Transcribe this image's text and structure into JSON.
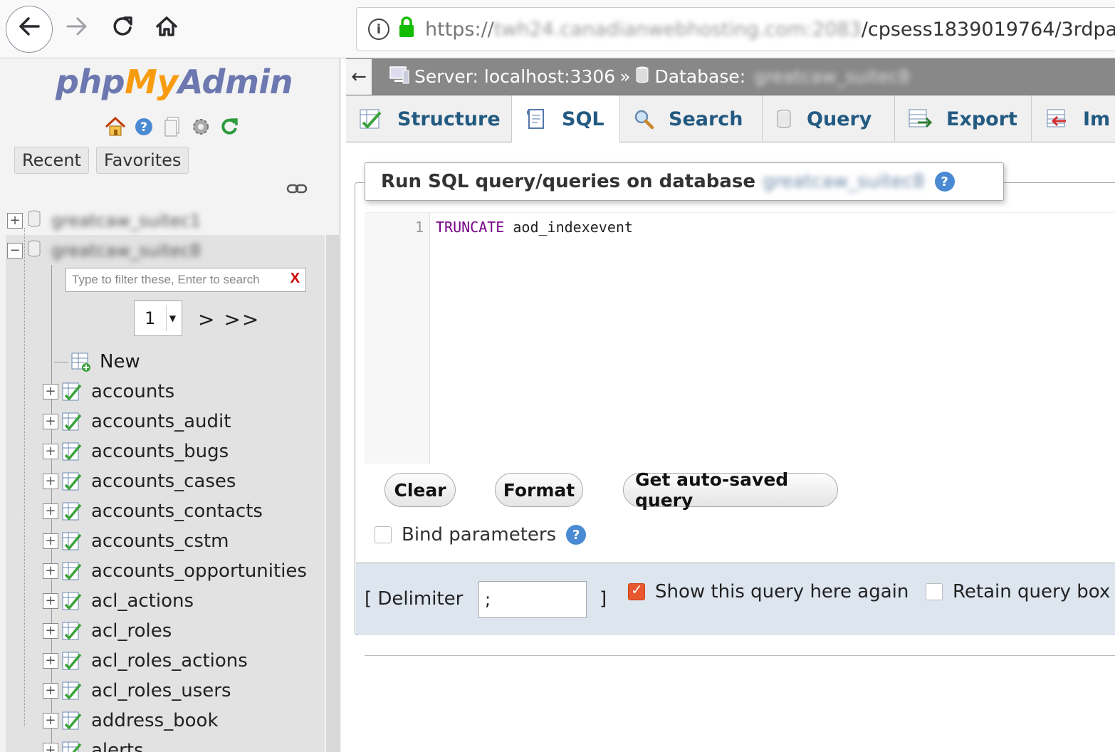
{
  "browser": {
    "url_scheme": "https://",
    "url_host": "twh24.canadianwebhosting.com:2083",
    "url_path": "/cpsess1839019764/3rdpa"
  },
  "nav": {
    "logo_php": "php",
    "logo_my": "My",
    "logo_admin": "Admin",
    "recent_label": "Recent",
    "favorites_label": "Favorites",
    "databases": [
      "greatcaw_suitec1",
      "greatcaw_suitec8"
    ],
    "filter_placeholder": "Type to filter these, Enter to search",
    "filter_clear": "X",
    "page_value": "1",
    "page_next": "> >>",
    "new_label": "New",
    "tables": [
      "accounts",
      "accounts_audit",
      "accounts_bugs",
      "accounts_cases",
      "accounts_contacts",
      "accounts_cstm",
      "accounts_opportunities",
      "acl_actions",
      "acl_roles",
      "acl_roles_actions",
      "acl_roles_users",
      "address_book",
      "alerts"
    ]
  },
  "topbar": {
    "collapse": "←",
    "server_label": "Server: localhost:3306",
    "separator": "»",
    "database_label": "Database:",
    "database_name": "greatcaw_suitec8"
  },
  "tabs": [
    "Structure",
    "SQL",
    "Search",
    "Query",
    "Export",
    "Im"
  ],
  "sql": {
    "legend_title": "Run SQL query/queries on database",
    "legend_db": "greatcaw_suitec8",
    "line_number": "1",
    "keyword": "TRUNCATE",
    "code_rest": " aod_indexevent",
    "clear_label": "Clear",
    "format_label": "Format",
    "autosave_label": "Get auto-saved query",
    "bind_label": "Bind parameters",
    "delimiter_open": "[ Delimiter",
    "delimiter_value": ";",
    "delimiter_close": "]",
    "show_again_label": "Show this query here again",
    "retain_label": "Retain query box"
  },
  "colors": {
    "accent_orange": "#e8572d",
    "tab_text": "#235a81",
    "logo_blue": "#6c78af",
    "logo_orange": "#f89c0e"
  }
}
